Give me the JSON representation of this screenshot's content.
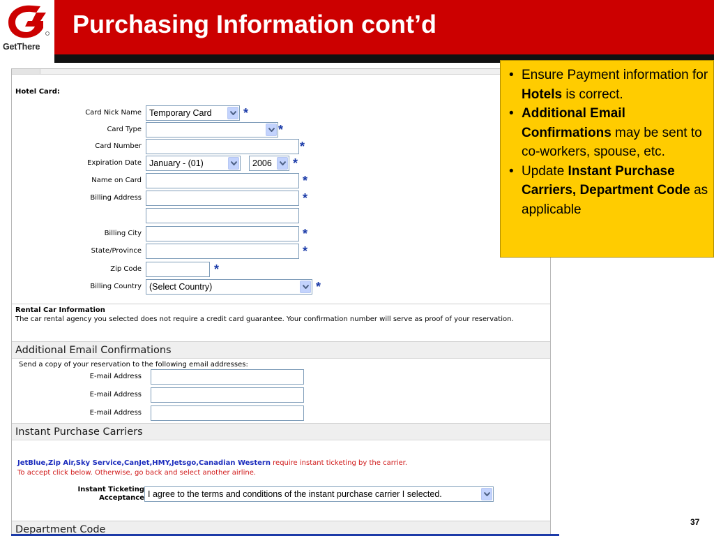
{
  "header": {
    "logo_text": "GetThere",
    "title": "Purchasing Information cont’d"
  },
  "hotel_card": {
    "title": "Hotel Card:",
    "fields": {
      "card_nick_name": {
        "label": "Card Nick Name",
        "value": "Temporary Card"
      },
      "card_type": {
        "label": "Card Type",
        "value": ""
      },
      "card_number": {
        "label": "Card Number",
        "value": ""
      },
      "expiration_date": {
        "label": "Expiration Date",
        "month": "January - (01)",
        "year": "2006"
      },
      "name_on_card": {
        "label": "Name on Card",
        "value": ""
      },
      "billing_address": {
        "label": "Billing Address",
        "value": "",
        "value2": ""
      },
      "billing_city": {
        "label": "Billing City",
        "value": ""
      },
      "state_province": {
        "label": "State/Province",
        "value": ""
      },
      "zip_code": {
        "label": "Zip Code",
        "value": ""
      },
      "billing_country": {
        "label": "Billing Country",
        "value": "(Select Country)"
      }
    },
    "required_mark": "*"
  },
  "rental_car": {
    "title": "Rental Car Information",
    "body": "The car rental agency you selected does not require a credit card guarantee. Your confirmation number will serve as proof of your reservation."
  },
  "additional_email": {
    "title": "Additional Email Confirmations",
    "note": "Send a copy of your reservation to the following email addresses:",
    "fields": [
      {
        "label": "E-mail Address",
        "value": ""
      },
      {
        "label": "E-mail Address",
        "value": ""
      },
      {
        "label": "E-mail Address",
        "value": ""
      }
    ]
  },
  "instant_purchase": {
    "title": "Instant Purchase Carriers",
    "carriers": "JetBlue,Zip Air,Sky Service,CanJet,HMY,Jetsgo,Canadian Western",
    "carriers_suffix": " require instant ticketing by the carrier.",
    "accept_note": "To accept click below. Otherwise, go back and select another airline.",
    "label_line1": "Instant Ticketing",
    "label_line2": "Acceptance",
    "select_value": "I agree to the terms and conditions of the instant purchase carrier I selected."
  },
  "department_code": {
    "title": "Department Code"
  },
  "callout": {
    "bullet": "•",
    "item1_pre": "Ensure Payment information for ",
    "item1_bold": "Hotels",
    "item1_post": " is correct.",
    "item2_bold": "Additional Email Confirmations",
    "item2_post": " may be sent to co-workers, spouse, etc.",
    "item3_pre": "Update ",
    "item3_bold": "Instant Purchase Carriers, Department Code",
    "item3_post": " as applicable"
  },
  "page_number": "37",
  "colors": {
    "brand_red": "#cc0000",
    "callout_yellow": "#ffcc00",
    "required_blue": "#1a3aa8",
    "carrier_blue": "#1c2dbd",
    "warning_red": "#d01a1a"
  },
  "icons": {
    "logo": "getthere-g-logo",
    "dropdown": "chevron-down-icon"
  }
}
